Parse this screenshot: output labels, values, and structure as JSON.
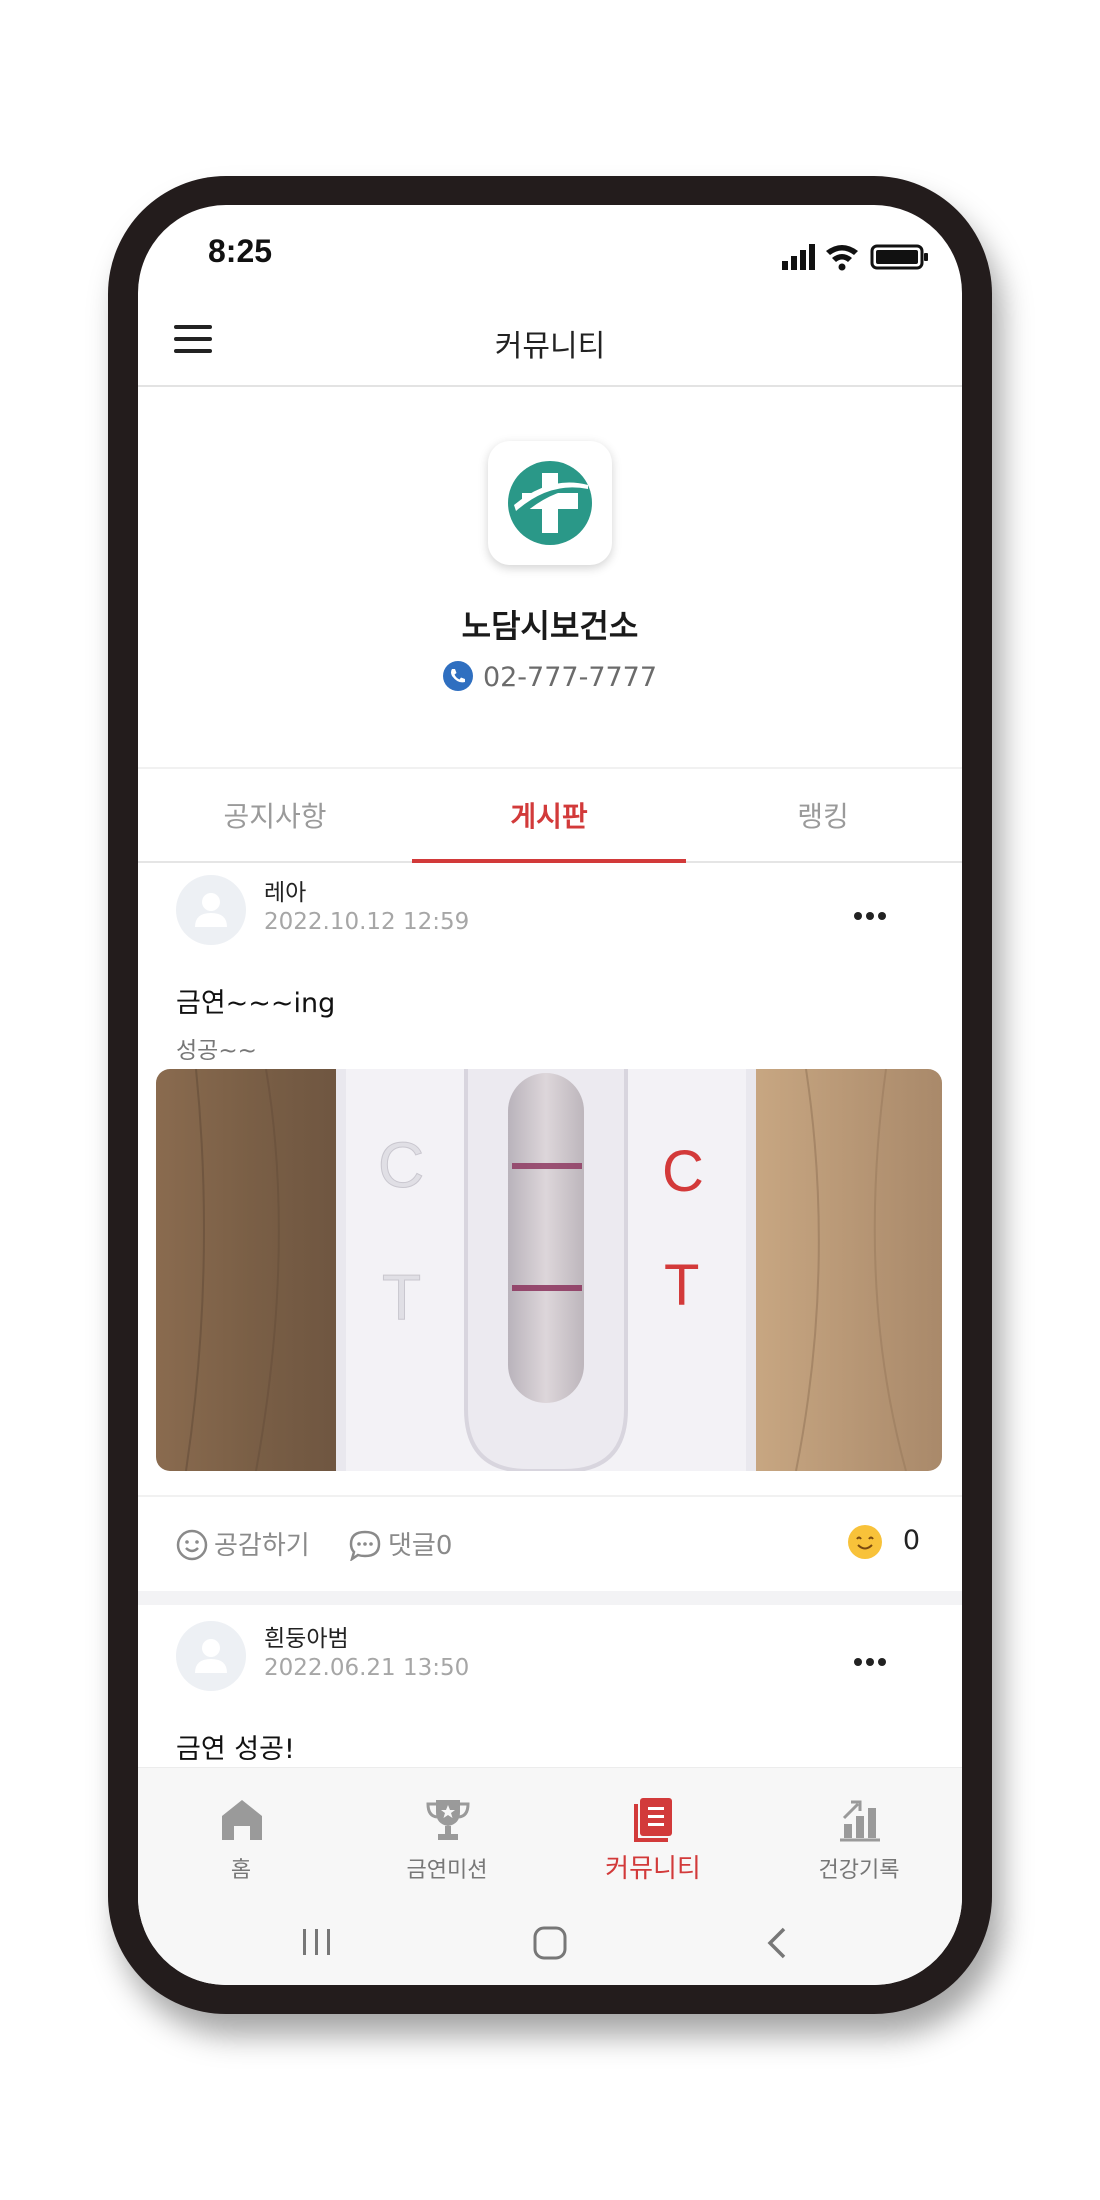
{
  "status": {
    "time": "8:25"
  },
  "header": {
    "title": "커뮤니티"
  },
  "profile": {
    "name": "노담시보건소",
    "phone": "02-777-7777"
  },
  "tabs": [
    {
      "label": "공지사항",
      "active": false
    },
    {
      "label": "게시판",
      "active": true
    },
    {
      "label": "랭킹",
      "active": false
    }
  ],
  "posts": [
    {
      "author": "레아",
      "date": "2022.10.12 12:59",
      "title": "금연~~~ing",
      "body": "성공~~",
      "photo": {
        "label_c_left": "C",
        "label_t_left": "T",
        "label_c_right": "C",
        "label_t_right": "T"
      },
      "actions": {
        "like_label": "공감하기",
        "comment_label": "댓글0",
        "reaction_count": "0"
      }
    },
    {
      "author": "흰둥아범",
      "date": "2022.06.21 13:50",
      "title": "금연 성공!"
    }
  ],
  "nav": [
    {
      "label": "홈",
      "icon": "home-icon",
      "active": false
    },
    {
      "label": "금연미션",
      "icon": "trophy-icon",
      "active": false
    },
    {
      "label": "커뮤니티",
      "icon": "community-icon",
      "active": true
    },
    {
      "label": "건강기록",
      "icon": "chart-icon",
      "active": false
    }
  ],
  "colors": {
    "accent": "#d23a3a",
    "logo": "#2a9888",
    "phone_icon": "#2f6fc0",
    "frame": "#231c1c"
  }
}
